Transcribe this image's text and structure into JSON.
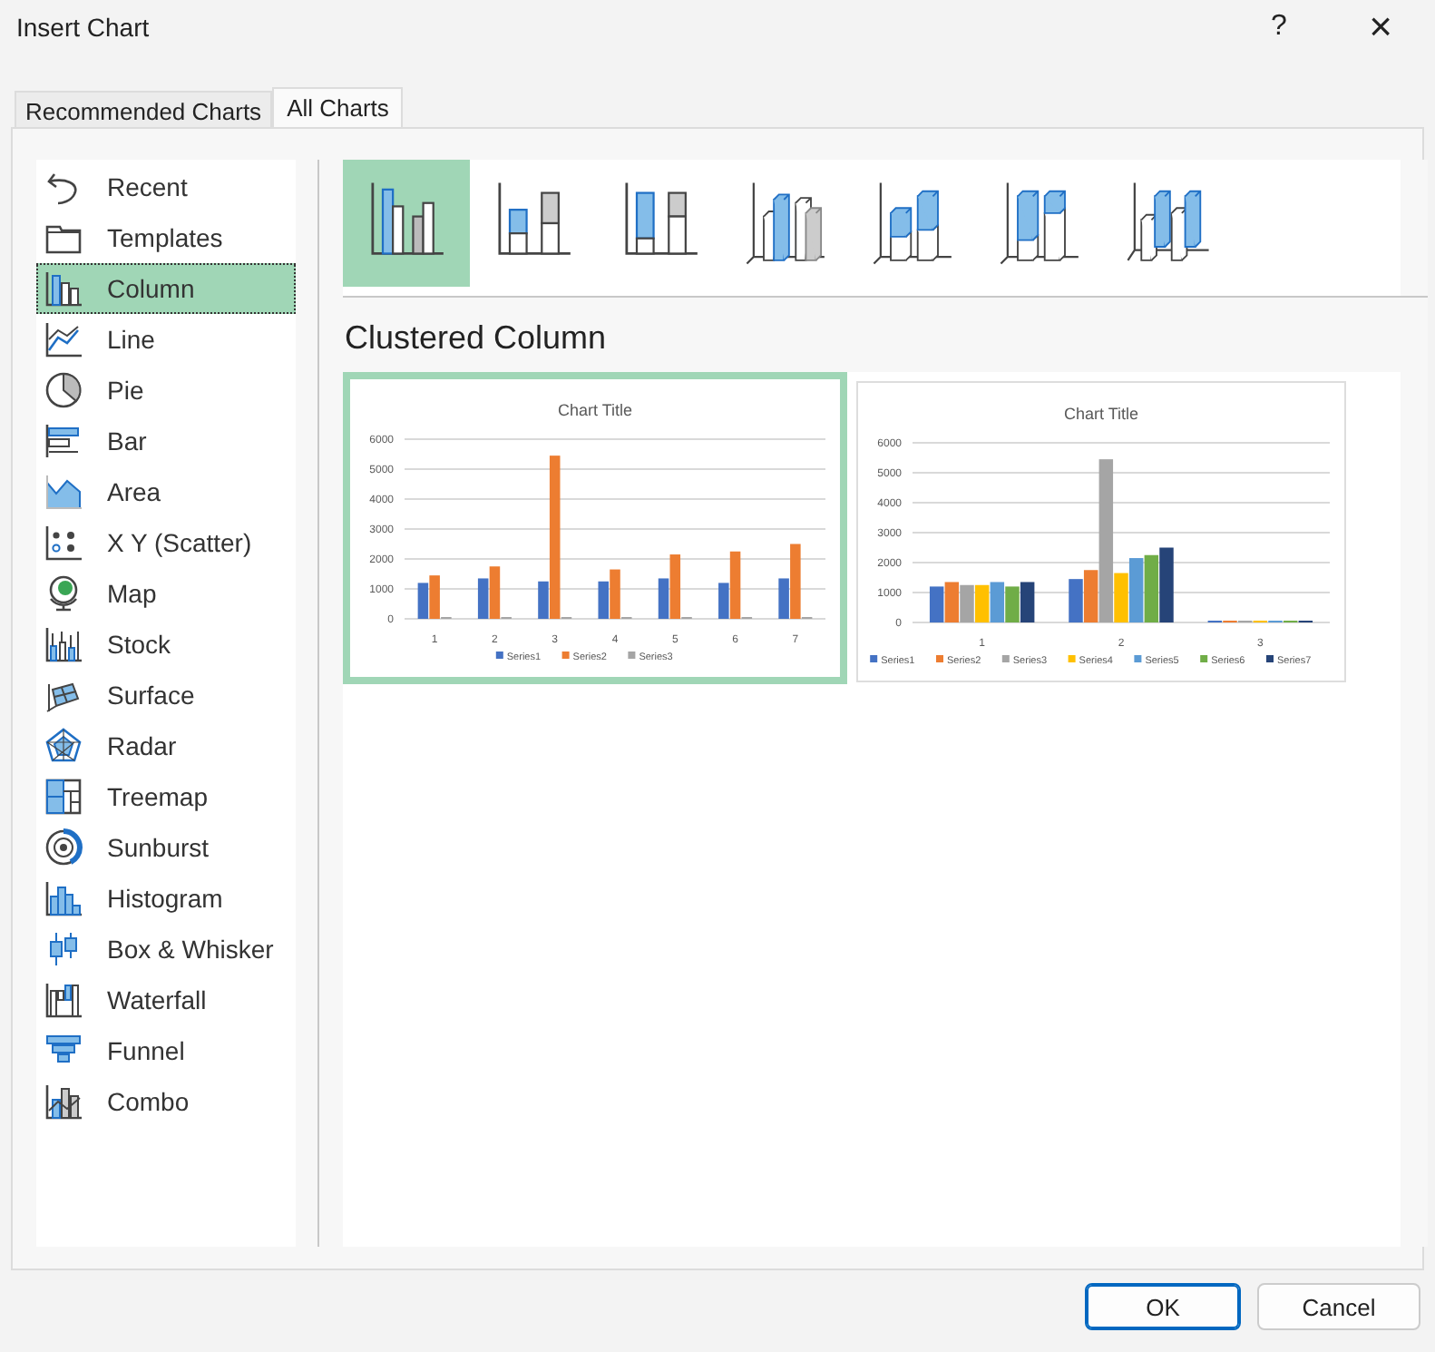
{
  "window": {
    "title": "Insert Chart",
    "help": "?",
    "close": "×"
  },
  "tabs": [
    {
      "label": "Recommended Charts",
      "selected": false
    },
    {
      "label": "All Charts",
      "selected": true
    }
  ],
  "sidebar": {
    "items": [
      {
        "label": "Recent",
        "selected": false
      },
      {
        "label": "Templates",
        "selected": false
      },
      {
        "label": "Column",
        "selected": true
      },
      {
        "label": "Line",
        "selected": false
      },
      {
        "label": "Pie",
        "selected": false
      },
      {
        "label": "Bar",
        "selected": false
      },
      {
        "label": "Area",
        "selected": false
      },
      {
        "label": "X Y (Scatter)",
        "selected": false
      },
      {
        "label": "Map",
        "selected": false
      },
      {
        "label": "Stock",
        "selected": false
      },
      {
        "label": "Surface",
        "selected": false
      },
      {
        "label": "Radar",
        "selected": false
      },
      {
        "label": "Treemap",
        "selected": false
      },
      {
        "label": "Sunburst",
        "selected": false
      },
      {
        "label": "Histogram",
        "selected": false
      },
      {
        "label": "Box & Whisker",
        "selected": false
      },
      {
        "label": "Waterfall",
        "selected": false
      },
      {
        "label": "Funnel",
        "selected": false
      },
      {
        "label": "Combo",
        "selected": false
      }
    ]
  },
  "subtypes": [
    {
      "selected": true
    },
    {
      "selected": false
    },
    {
      "selected": false
    },
    {
      "selected": false
    },
    {
      "selected": false
    },
    {
      "selected": false
    },
    {
      "selected": false
    }
  ],
  "subtype_title": "Clustered Column",
  "previews": [
    {
      "selected": true,
      "chart_data": {
        "type": "bar",
        "title": "Chart Title",
        "categories": [
          "1",
          "2",
          "3",
          "4",
          "5",
          "6",
          "7"
        ],
        "ylim": [
          0,
          6000
        ],
        "yticks": [
          0,
          1000,
          2000,
          3000,
          4000,
          5000,
          6000
        ],
        "grid": true,
        "legend": "bottom",
        "series": [
          {
            "name": "Series1",
            "color": "#4472c4",
            "values": [
              1200,
              1350,
              1250,
              1250,
              1350,
              1200,
              1350
            ]
          },
          {
            "name": "Series2",
            "color": "#ed7d31",
            "values": [
              1450,
              1750,
              5450,
              1650,
              2150,
              2250,
              2500
            ]
          },
          {
            "name": "Series3",
            "color": "#a5a5a5",
            "values": [
              0,
              0,
              0,
              0,
              0,
              0,
              0
            ]
          }
        ]
      }
    },
    {
      "selected": false,
      "chart_data": {
        "type": "bar",
        "title": "Chart Title",
        "categories": [
          "1",
          "2",
          "3"
        ],
        "ylim": [
          0,
          6000
        ],
        "yticks": [
          0,
          1000,
          2000,
          3000,
          4000,
          5000,
          6000
        ],
        "grid": true,
        "legend": "bottom",
        "series": [
          {
            "name": "Series1",
            "color": "#4472c4",
            "values": [
              1200,
              1450,
              0
            ]
          },
          {
            "name": "Series2",
            "color": "#ed7d31",
            "values": [
              1350,
              1750,
              0
            ]
          },
          {
            "name": "Series3",
            "color": "#a5a5a5",
            "values": [
              1250,
              5450,
              0
            ]
          },
          {
            "name": "Series4",
            "color": "#ffc000",
            "values": [
              1250,
              1650,
              0
            ]
          },
          {
            "name": "Series5",
            "color": "#5b9bd5",
            "values": [
              1350,
              2150,
              0
            ]
          },
          {
            "name": "Series6",
            "color": "#70ad47",
            "values": [
              1200,
              2250,
              0
            ]
          },
          {
            "name": "Series7",
            "color": "#264478",
            "values": [
              1350,
              2500,
              0
            ]
          }
        ]
      }
    }
  ],
  "buttons": [
    {
      "label": "OK",
      "kind": "primary"
    },
    {
      "label": "Cancel",
      "kind": "secondary"
    }
  ]
}
